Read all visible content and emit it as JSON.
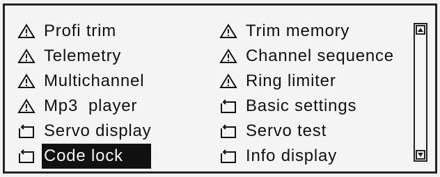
{
  "menu": {
    "left": [
      {
        "icon": "warning-icon",
        "label": "Profi trim"
      },
      {
        "icon": "warning-icon",
        "label": "Telemetry"
      },
      {
        "icon": "warning-icon",
        "label": "Multichannel"
      },
      {
        "icon": "warning-icon",
        "label": "Mp3  player"
      },
      {
        "icon": "folder-return-icon",
        "label": "Servo display"
      },
      {
        "icon": "folder-return-icon",
        "label": "Code lock"
      }
    ],
    "right": [
      {
        "icon": "warning-icon",
        "label": "Trim memory"
      },
      {
        "icon": "warning-icon",
        "label": "Channel sequence"
      },
      {
        "icon": "warning-icon",
        "label": "Ring limiter"
      },
      {
        "icon": "folder-return-icon",
        "label": "Basic settings"
      },
      {
        "icon": "folder-return-icon",
        "label": "Servo test"
      },
      {
        "icon": "folder-return-icon",
        "label": "Info display"
      }
    ],
    "selected_label": "Code lock"
  },
  "scrollbar": {
    "up_icon": "triangle-up-icon",
    "down_icon": "triangle-down-icon"
  },
  "colors": {
    "screen_bg": "#f4f4f4",
    "text": "#111111",
    "selection_bg": "#111111"
  }
}
